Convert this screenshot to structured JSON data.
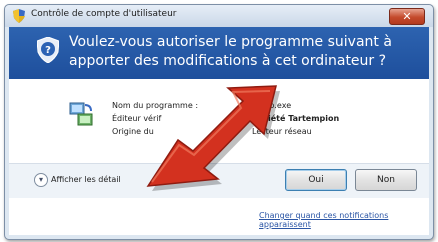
{
  "window": {
    "title": "Contrôle de compte d'utilisateur",
    "close_label": "✕"
  },
  "header": {
    "message": "Voulez-vous autoriser le programme suivant à apporter des modifications à cet ordinateur ?"
  },
  "program": {
    "name_label": "Nom du programme :",
    "name_value": "setup.exe",
    "publisher_label": "Éditeur vérif",
    "publisher_value": "Société Tartempion",
    "origin_label": "Origine du",
    "origin_value": "Lecteur réseau"
  },
  "details": {
    "label": "Afficher les détail"
  },
  "buttons": {
    "yes_label": "Oui",
    "no_label": "Non"
  },
  "footer": {
    "link_label": "Changer quand ces notifications apparaissent"
  },
  "colors": {
    "header_blue": "#2459a8",
    "arrow_red": "#d3311f",
    "link_blue": "#2a55a5"
  },
  "icons": [
    "shield-icon",
    "program-icon",
    "chevron-down-icon",
    "close-icon",
    "red-arrow-overlay"
  ]
}
